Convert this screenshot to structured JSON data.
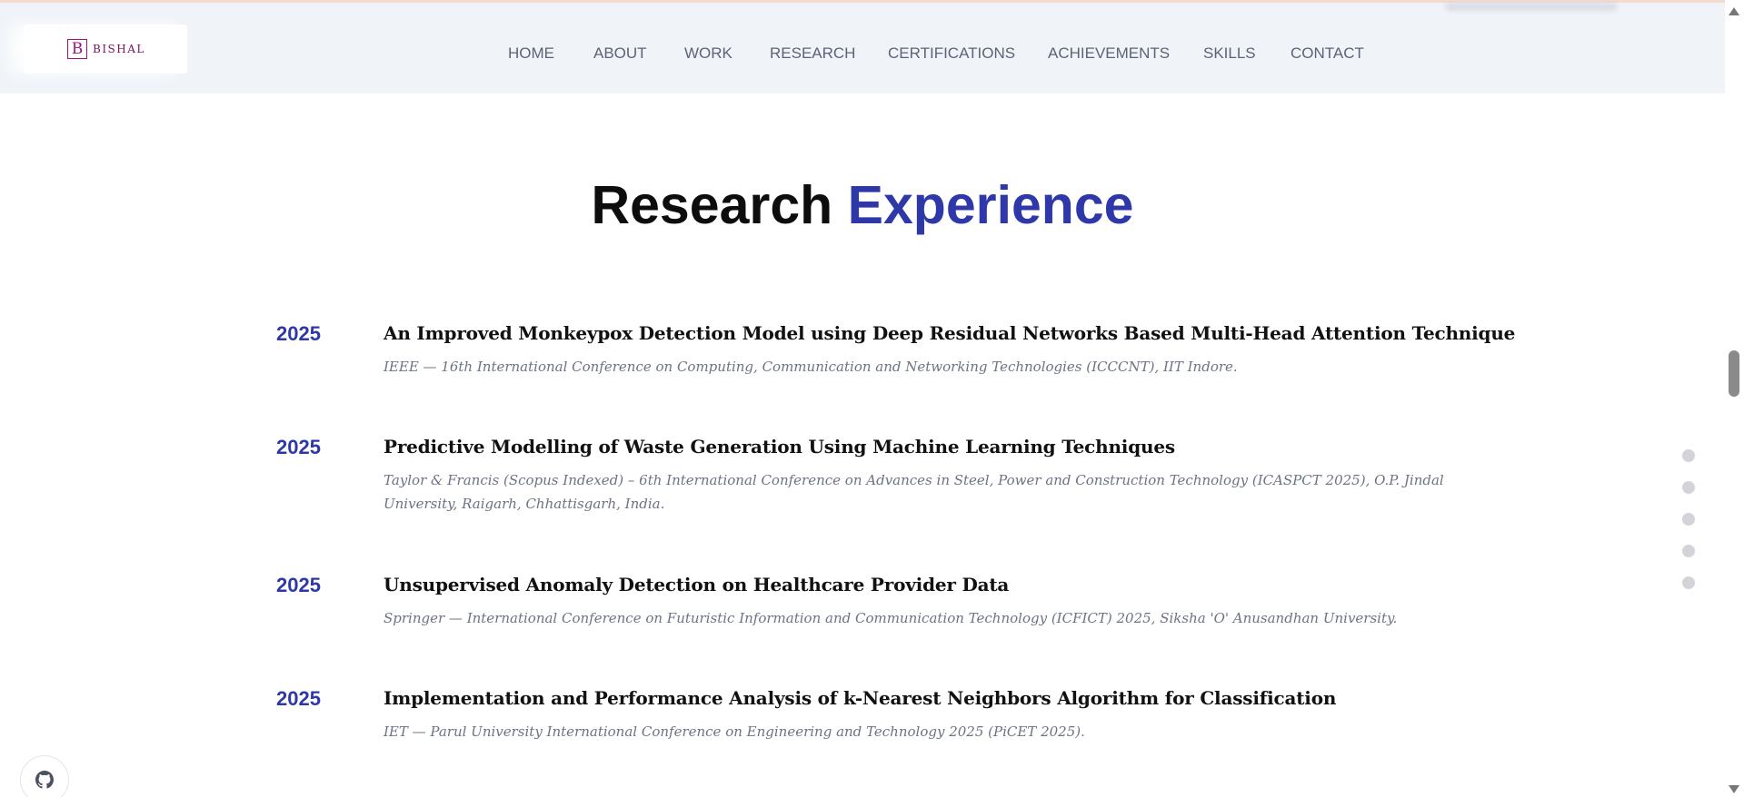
{
  "brand": {
    "initial": "B",
    "name": "BISHAL"
  },
  "nav": {
    "items": [
      "HOME",
      "ABOUT",
      "WORK",
      "RESEARCH",
      "CERTIFICATIONS",
      "ACHIEVEMENTS",
      "SKILLS",
      "CONTACT"
    ]
  },
  "section": {
    "title_main": "Research",
    "title_accent": "Experience"
  },
  "entries": [
    {
      "year": "2025",
      "title": "An Improved Monkeypox Detection Model using Deep Residual Networks Based Multi-Head Attention Technique",
      "venue": "IEEE — 16th International Conference on Computing, Communication and Networking Technologies (ICCCNT), IIT Indore."
    },
    {
      "year": "2025",
      "title": "Predictive Modelling of Waste Generation Using Machine Learning Techniques",
      "venue": "Taylor & Francis (Scopus Indexed) – 6th International Conference on Advances in Steel, Power and Construction Technology (ICASPCT 2025), O.P. Jindal University, Raigarh, Chhattisgarh, India."
    },
    {
      "year": "2025",
      "title": "Unsupervised Anomaly Detection on Healthcare Provider Data",
      "venue": "Springer — International Conference on Futuristic Information and Communication Technology (ICFICT) 2025, Siksha 'O' Anusandhan University."
    },
    {
      "year": "2025",
      "title": "Implementation and Performance Analysis of k-Nearest Neighbors Algorithm for Classification",
      "venue": "IET — Parul University International Conference on Engineering and Technology 2025 (PiCET 2025)."
    }
  ],
  "side_dots": {
    "count": 5
  },
  "icons": {
    "github": "github-icon"
  },
  "colors": {
    "accent": "#2f38a8",
    "navbar_bg": "#f0f4f9",
    "brand": "#a0147a"
  }
}
